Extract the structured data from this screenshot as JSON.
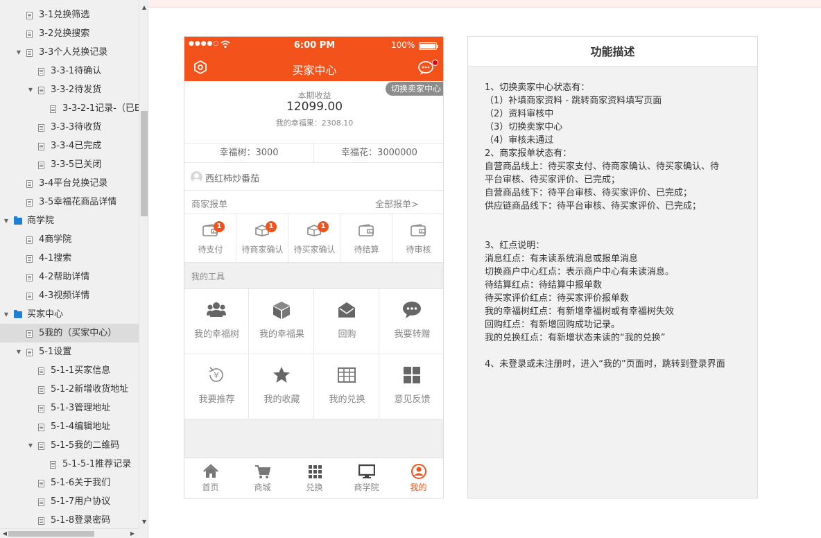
{
  "sidebar": {
    "items": [
      {
        "label": "3-1兑换筛选",
        "level": 2,
        "type": "page",
        "expander": "",
        "selected": false
      },
      {
        "label": "3-2兑换搜索",
        "level": 2,
        "type": "page",
        "expander": "",
        "selected": false
      },
      {
        "label": "3-3个人兑换记录",
        "level": 2,
        "type": "page",
        "expander": "expanded",
        "selected": false
      },
      {
        "label": "3-3-1待确认",
        "level": 3,
        "type": "page",
        "expander": "",
        "selected": false
      },
      {
        "label": "3-3-2待发货",
        "level": 3,
        "type": "page",
        "expander": "expanded",
        "selected": false
      },
      {
        "label": "3-3-2-1记录-（已E",
        "level": 4,
        "type": "page",
        "expander": "",
        "selected": false
      },
      {
        "label": "3-3-3待收货",
        "level": 3,
        "type": "page",
        "expander": "",
        "selected": false
      },
      {
        "label": "3-3-4已完成",
        "level": 3,
        "type": "page",
        "expander": "",
        "selected": false
      },
      {
        "label": "3-3-5已关闭",
        "level": 3,
        "type": "page",
        "expander": "",
        "selected": false
      },
      {
        "label": "3-4平台兑换记录",
        "level": 2,
        "type": "page",
        "expander": "",
        "selected": false
      },
      {
        "label": "3-5幸福花商品详情",
        "level": 2,
        "type": "page",
        "expander": "",
        "selected": false
      },
      {
        "label": "商学院",
        "level": 1,
        "type": "folder",
        "expander": "expanded",
        "selected": false
      },
      {
        "label": "4商学院",
        "level": 2,
        "type": "page",
        "expander": "",
        "selected": false
      },
      {
        "label": "4-1搜索",
        "level": 2,
        "type": "page",
        "expander": "",
        "selected": false
      },
      {
        "label": "4-2帮助详情",
        "level": 2,
        "type": "page",
        "expander": "",
        "selected": false
      },
      {
        "label": "4-3视频详情",
        "level": 2,
        "type": "page",
        "expander": "",
        "selected": false
      },
      {
        "label": "买家中心",
        "level": 1,
        "type": "folder",
        "expander": "expanded",
        "selected": false
      },
      {
        "label": "5我的（买家中心）",
        "level": 2,
        "type": "page",
        "expander": "",
        "selected": true
      },
      {
        "label": "5-1设置",
        "level": 2,
        "type": "page",
        "expander": "expanded",
        "selected": false
      },
      {
        "label": "5-1-1买家信息",
        "level": 3,
        "type": "page",
        "expander": "",
        "selected": false
      },
      {
        "label": "5-1-2新增收货地址",
        "level": 3,
        "type": "page",
        "expander": "",
        "selected": false
      },
      {
        "label": "5-1-3管理地址",
        "level": 3,
        "type": "page",
        "expander": "",
        "selected": false
      },
      {
        "label": "5-1-4编辑地址",
        "level": 3,
        "type": "page",
        "expander": "",
        "selected": false
      },
      {
        "label": "5-1-5我的二维码",
        "level": 3,
        "type": "page",
        "expander": "expanded",
        "selected": false
      },
      {
        "label": "5-1-5-1推荐记录",
        "level": 4,
        "type": "page",
        "expander": "",
        "selected": false
      },
      {
        "label": "5-1-6关于我们",
        "level": 3,
        "type": "page",
        "expander": "",
        "selected": false
      },
      {
        "label": "5-1-7用户协议",
        "level": 3,
        "type": "page",
        "expander": "",
        "selected": false
      },
      {
        "label": "5-1-8登录密码",
        "level": 3,
        "type": "page",
        "expander": "",
        "selected": false
      }
    ]
  },
  "phone": {
    "status": {
      "signal": "●●●●○",
      "time": "6:00 PM",
      "battery": "100%"
    },
    "header": {
      "title": "买家中心",
      "left_icon": "settings-hex-icon",
      "right_icon": "message-icon"
    },
    "summary": {
      "switch_label": "切换卖家中心",
      "period_label": "本期收益",
      "period_value": "12099.00",
      "fruit_text": "我的幸福果：2308.10"
    },
    "tree_text": "幸福树：3000",
    "flower_text": "幸福花：3000000",
    "user_name": "西红柿炒番茄",
    "orders": {
      "title": "商家报单",
      "all_link": "全部报单>",
      "items": [
        {
          "label": "待支付",
          "badge": "1",
          "icon": "wallet-icon"
        },
        {
          "label": "待商家确认",
          "badge": "1",
          "icon": "box-icon"
        },
        {
          "label": "待买家确认",
          "badge": "1",
          "icon": "box-icon"
        },
        {
          "label": "待结算",
          "badge": "",
          "icon": "wallet-icon"
        },
        {
          "label": "待审核",
          "badge": "",
          "icon": "wallet-icon"
        }
      ]
    },
    "tools": {
      "title": "我的工具",
      "items": [
        {
          "label": "我的幸福树",
          "icon": "users-icon"
        },
        {
          "label": "我的幸福果",
          "icon": "cube-icon"
        },
        {
          "label": "回购",
          "icon": "envelope-icon"
        },
        {
          "label": "我要转赠",
          "icon": "chat-icon"
        },
        {
          "label": "我要推荐",
          "icon": "yen-refresh-icon"
        },
        {
          "label": "我的收藏",
          "icon": "star-icon"
        },
        {
          "label": "我的兑换",
          "icon": "grid-table-icon"
        },
        {
          "label": "意见反馈",
          "icon": "tiles-icon"
        }
      ]
    },
    "tabs": [
      {
        "label": "首页",
        "icon": "home-icon",
        "active": false
      },
      {
        "label": "商城",
        "icon": "cart-icon",
        "active": false
      },
      {
        "label": "兑换",
        "icon": "dots-grid-icon",
        "active": false
      },
      {
        "label": "商学院",
        "icon": "monitor-icon",
        "active": false
      },
      {
        "label": "我的",
        "icon": "user-circle-icon",
        "active": true
      }
    ]
  },
  "description": {
    "title": "功能描述",
    "lines": [
      "1、切换卖家中心状态有：",
      "（1）补填商家资料 - 跳转商家资料填写页面",
      "（2）资料审核中",
      "（3）切换卖家中心",
      "（4）审核未通过",
      "2、商家报单状态有：",
      "自营商品线上：待买家支付、待商家确认、待买家确认、待",
      "平台审核、待买家评价、已完成；",
      "自营商品线下：待平台审核、待买家评价、已完成；",
      "供应链商品线下：待平台审核、待买家评价、已完成；",
      "",
      "",
      "3、红点说明：",
      "消息红点：有未读系统消息或报单消息",
      "切换商户中心红点：表示商户中心有未读消息。",
      "待结算红点：待结算中报单数",
      "待买家评价红点：待买家评价报单数",
      " 我的幸福树红点：有新增幸福树或有幸福树失效",
      "回购红点：有新增回购成功记录。",
      "我的兑换红点：有新增状态未读的“我的兑换”",
      "",
      "4、未登录或未注册时，进入“我的”页面时，跳转到登录界面"
    ]
  },
  "colors": {
    "brand": "#f4521b",
    "badge": "#f4521b",
    "folder": "#1e7fd4",
    "active_tab": "#f4521b"
  }
}
